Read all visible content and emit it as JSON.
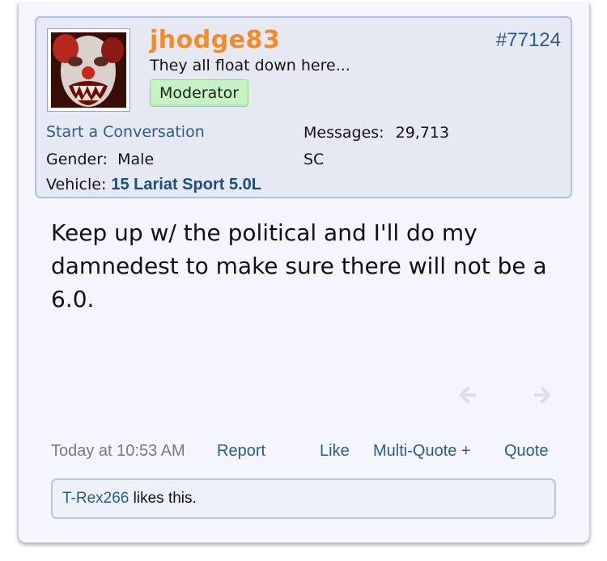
{
  "post": {
    "username": "jhodge83",
    "user_title": "They all float down here...",
    "rank_badge": "Moderator",
    "post_number": "#77124",
    "start_conversation": "Start a Conversation",
    "messages_label": "Messages:",
    "messages_value": "29,713",
    "location": "SC",
    "gender_label": "Gender:",
    "gender_value": "Male",
    "vehicle_label": "Vehicle:",
    "vehicle_value": "15 Lariat Sport 5.0L",
    "message_text": "Keep up w/ the political and I'll do my damnedest to make sure there will not be a 6.0.",
    "footer": {
      "date": "Today at 10:53 AM",
      "report": "Report",
      "like": "Like",
      "multi_quote": "Multi-Quote +",
      "quote": "Quote"
    },
    "likes": {
      "liker": "T-Rex266",
      "suffix": " likes this."
    }
  },
  "colors": {
    "username": "#f28c28",
    "link": "#2c5d86",
    "badge_bg": "#c6f3c1",
    "post_bg": "#f4f5fd",
    "userbox_bg": "#e6e8f4"
  },
  "icons": [
    "avatar-image",
    "arrow-left-icon",
    "arrow-right-icon"
  ]
}
